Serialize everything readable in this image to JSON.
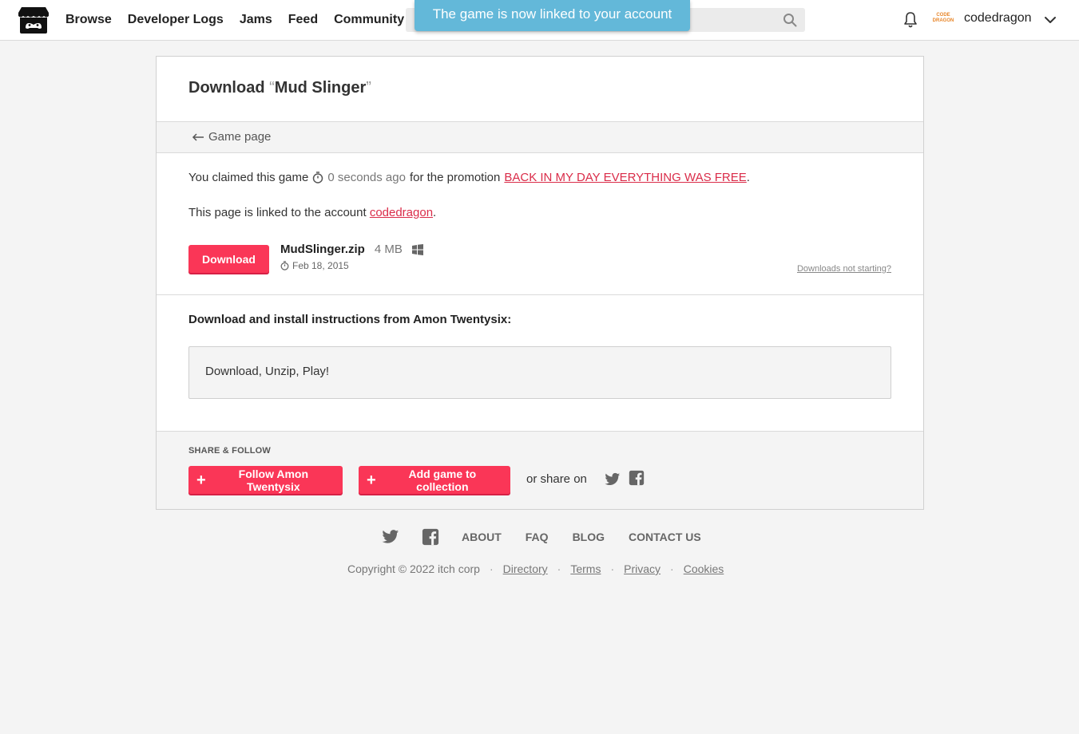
{
  "header": {
    "nav": [
      "Browse",
      "Developer Logs",
      "Jams",
      "Feed",
      "Community"
    ],
    "search_placeholder": "",
    "username": "codedragon",
    "avatar_text": "CODE DRAGON"
  },
  "toast": "The game is now linked to your account",
  "page": {
    "title_prefix": "Download",
    "open_quote": "“",
    "game_title": "Mud Slinger",
    "close_quote": "”",
    "back_link": "Game page",
    "claim_prefix": "You claimed this game",
    "claim_time": "0 seconds ago",
    "claim_middle": "for the promotion",
    "promotion": "BACK IN MY DAY EVERYTHING WAS FREE",
    "period": ".",
    "linked_prefix": "This page is linked to the account",
    "linked_account": "codedragon",
    "download_button": "Download",
    "file_name": "MudSlinger.zip",
    "file_size": "4 MB",
    "file_date": "Feb 18, 2015",
    "not_starting": "Downloads not starting?",
    "instructions_title": "Download and install instructions from Amon Twentysix:",
    "instructions_body": "Download, Unzip, Play!",
    "share_title": "SHARE & FOLLOW",
    "follow_button": "Follow Amon Twentysix",
    "collection_button": "Add game to collection",
    "or_share": "or share on"
  },
  "footer": {
    "links": [
      "ABOUT",
      "FAQ",
      "BLOG",
      "CONTACT US"
    ],
    "copyright": "Copyright © 2022 itch corp",
    "legal": [
      "Directory",
      "Terms",
      "Privacy",
      "Cookies"
    ],
    "separator": "·"
  },
  "colors": {
    "accent": "#fa3657",
    "link": "#da2c49",
    "toast": "#63b8d9"
  }
}
